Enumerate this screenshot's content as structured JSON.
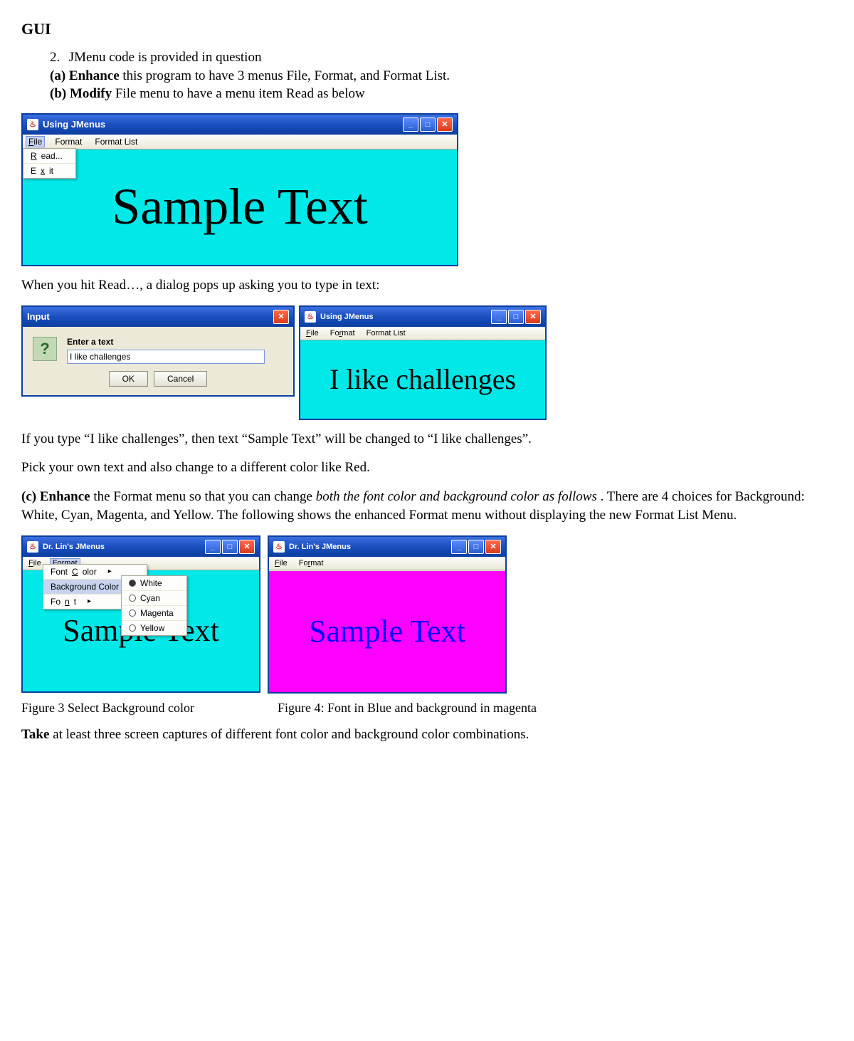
{
  "heading": "GUI",
  "item2": {
    "num": "2.",
    "text": "JMenu code is provided in question"
  },
  "partA": {
    "label": "(a)",
    "verb": "Enhance",
    "rest": " this program to have 3 menus File, Format, and Format List."
  },
  "partB": {
    "label": "(b)",
    "verb": "Modify",
    "rest": " File menu to have a menu item Read as below"
  },
  "win1": {
    "title": "Using JMenus",
    "menus": {
      "file": "File",
      "format": "Format",
      "formatList": "Format List"
    },
    "fileMenu": {
      "read": "Read...",
      "exit": "Exit"
    },
    "contentText": "Sample Text"
  },
  "para1": "When you hit Read…, a dialog pops up asking you to type in text:",
  "inputDlg": {
    "title": "Input",
    "prompt": "Enter a text",
    "value": "I like challenges",
    "ok": "OK",
    "cancel": "Cancel"
  },
  "win2": {
    "title": "Using JMenus",
    "menus": {
      "file": "File",
      "format": "Format",
      "formatList": "Format List"
    },
    "contentText": "I like challenges"
  },
  "para2": "If you type “I like challenges”, then text “Sample Text” will be changed to “I like challenges”.",
  "para3": "Pick your own text and also change to a different color like Red.",
  "partC": {
    "label": "(c)",
    "verb": "Enhance",
    "rest1": " the Format menu so that you can change ",
    "italic": "both the font color and background color as follows",
    "rest2": ". There are 4 choices for Background: White, Cyan, Magenta, and Yellow. The following shows the enhanced Format menu without displaying the new Format List Menu."
  },
  "win3": {
    "title": "Dr. Lin's JMenus",
    "menus": {
      "file": "File",
      "format": "Format"
    },
    "formatMenu": {
      "fontColor": "Font Color",
      "bgColor": "Background Color",
      "font": "Font"
    },
    "bgMenu": {
      "white": "White",
      "cyan": "Cyan",
      "magenta": "Magenta",
      "yellow": "Yellow"
    },
    "contentText": "Sample Text"
  },
  "win4": {
    "title": "Dr. Lin's JMenus",
    "menus": {
      "file": "File",
      "format": "Format"
    },
    "contentText": "Sample Text"
  },
  "fig3": "Figure 3 Select Background color",
  "fig4": "Figure 4: Font in Blue and background in magenta",
  "takeLine": {
    "verb": "Take",
    "rest": " at least three screen captures of different font color and background color combinations."
  }
}
